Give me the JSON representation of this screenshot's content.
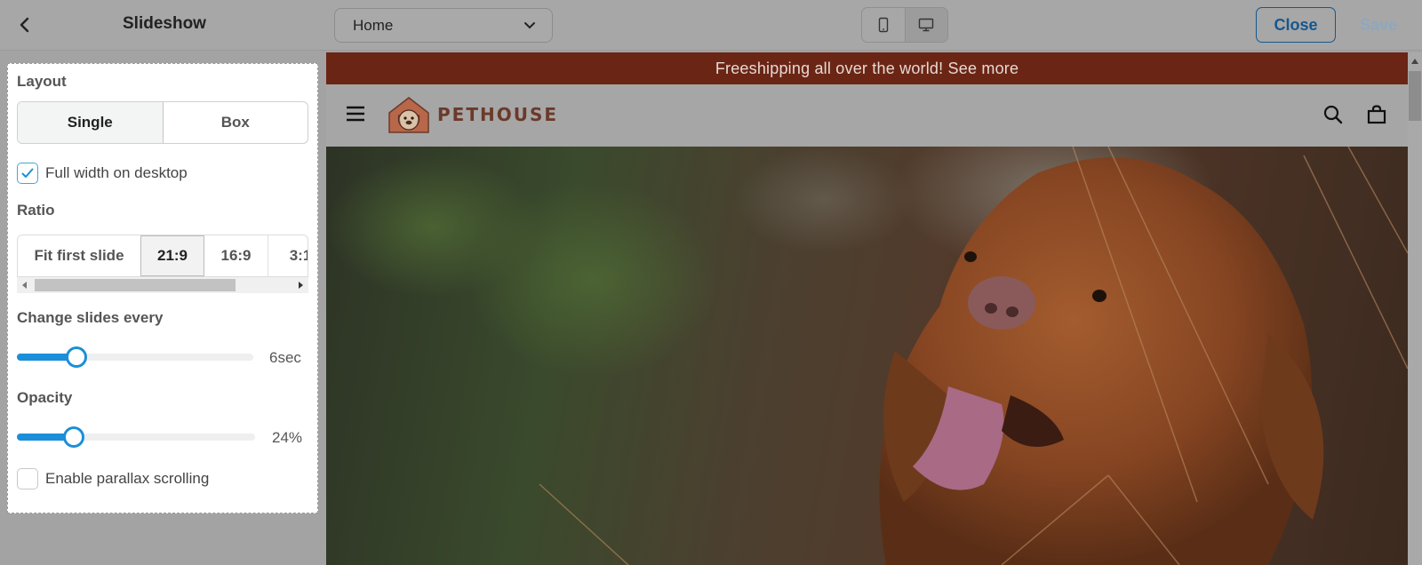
{
  "topbar": {
    "title": "Slideshow",
    "page_select_value": "Home",
    "close_label": "Close",
    "save_label": "Save",
    "device_buttons": [
      "mobile-icon",
      "desktop-icon"
    ]
  },
  "panel": {
    "layout_label": "Layout",
    "layout_options": [
      "Single",
      "Box"
    ],
    "layout_selected": "Single",
    "full_width_label": "Full width on desktop",
    "full_width_checked": true,
    "ratio_label": "Ratio",
    "ratio_options": [
      "Fit first slide",
      "21:9",
      "16:9",
      "3:1"
    ],
    "ratio_selected": "21:9",
    "change_slides_label": "Change slides every",
    "change_slides_value": "6sec",
    "change_slides_fraction": 0.25,
    "opacity_label": "Opacity",
    "opacity_value": "24%",
    "opacity_fraction": 0.24,
    "parallax_label": "Enable parallax scrolling",
    "parallax_checked": false
  },
  "preview": {
    "announcement": "Freeshipping all over the world! See more",
    "logo_text": "PETHOUSE",
    "icons": [
      "menu-icon",
      "search-icon",
      "bag-icon"
    ]
  },
  "colors": {
    "accent": "#1b8fd9",
    "close_border": "#15588e",
    "announcement_bg": "#6b2515"
  }
}
